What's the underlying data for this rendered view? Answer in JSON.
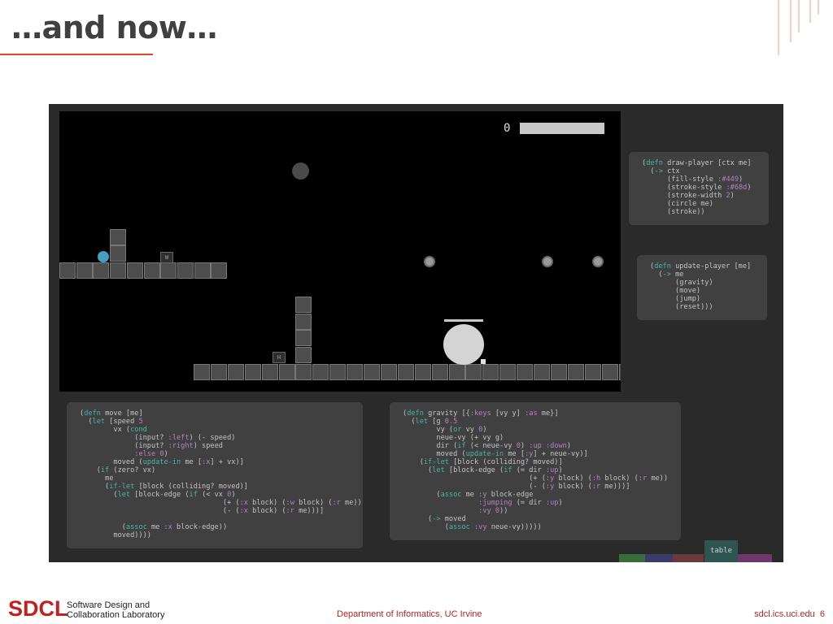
{
  "slide": {
    "title": "…and now…",
    "page_number": "6"
  },
  "colors": {
    "accent": "#e0491b",
    "brand": "#c0201e",
    "keyword": "#46b5a3",
    "constant": "#b380c8",
    "player": "#449ec0"
  },
  "game": {
    "score": "0",
    "health_fraction": 1.0,
    "markers": [
      "W",
      "H"
    ]
  },
  "code_panels": {
    "draw_player": [
      [
        [
          "p",
          "("
        ],
        [
          "k",
          "defn"
        ],
        [
          "p",
          " draw-player [ctx me]"
        ]
      ],
      [
        [
          "p",
          "  ("
        ],
        [
          "k",
          "->"
        ],
        [
          "p",
          " ctx"
        ]
      ],
      [
        [
          "p",
          "      (fill-style "
        ],
        [
          "c",
          ":#449"
        ],
        [
          "p",
          ")"
        ]
      ],
      [
        [
          "p",
          "      (stroke-style "
        ],
        [
          "c",
          ":#68d"
        ],
        [
          "p",
          ")"
        ]
      ],
      [
        [
          "p",
          "      (stroke-width "
        ],
        [
          "c",
          "2"
        ],
        [
          "p",
          ")"
        ]
      ],
      [
        [
          "p",
          "      (circle me)"
        ]
      ],
      [
        [
          "p",
          "      (stroke))"
        ]
      ]
    ],
    "update_player": [
      [
        [
          "p",
          "("
        ],
        [
          "k",
          "defn"
        ],
        [
          "p",
          " update-player [me]"
        ]
      ],
      [
        [
          "p",
          "  ("
        ],
        [
          "k",
          "->"
        ],
        [
          "p",
          " me"
        ]
      ],
      [
        [
          "p",
          "      (gravity)"
        ]
      ],
      [
        [
          "p",
          "      (move)"
        ]
      ],
      [
        [
          "p",
          "      (jump)"
        ]
      ],
      [
        [
          "p",
          "      (reset)))"
        ]
      ]
    ],
    "move": [
      [
        [
          "p",
          "("
        ],
        [
          "k",
          "defn"
        ],
        [
          "p",
          " move [me]"
        ]
      ],
      [
        [
          "p",
          "  ("
        ],
        [
          "k",
          "let"
        ],
        [
          "p",
          " [speed "
        ],
        [
          "c",
          "5"
        ]
      ],
      [
        [
          "p",
          "        vx ("
        ],
        [
          "k",
          "cond"
        ]
      ],
      [
        [
          "p",
          "             (input? "
        ],
        [
          "c",
          ":left"
        ],
        [
          "p",
          ") (- speed)"
        ]
      ],
      [
        [
          "p",
          "             (input? "
        ],
        [
          "c",
          ":right"
        ],
        [
          "p",
          ") speed"
        ]
      ],
      [
        [
          "p",
          "             "
        ],
        [
          "c",
          ":else"
        ],
        [
          "p",
          " "
        ],
        [
          "c",
          "0"
        ],
        [
          "p",
          ")"
        ]
      ],
      [
        [
          "p",
          "        moved ("
        ],
        [
          "k",
          "update-in"
        ],
        [
          "p",
          " me ["
        ],
        [
          "c",
          ":x"
        ],
        [
          "p",
          "] + vx)]"
        ]
      ],
      [
        [
          "p",
          "    ("
        ],
        [
          "k",
          "if"
        ],
        [
          "p",
          " (zero? vx)"
        ]
      ],
      [
        [
          "p",
          "      me"
        ]
      ],
      [
        [
          "p",
          "      ("
        ],
        [
          "k",
          "if-let"
        ],
        [
          "p",
          " [block (colliding? moved)]"
        ]
      ],
      [
        [
          "p",
          "        ("
        ],
        [
          "k",
          "let"
        ],
        [
          "p",
          " [block-edge ("
        ],
        [
          "k",
          "if"
        ],
        [
          "p",
          " (< vx "
        ],
        [
          "c",
          "0"
        ],
        [
          "p",
          ")"
        ]
      ],
      [
        [
          "p",
          "                                  (+ ("
        ],
        [
          "c",
          ":x"
        ],
        [
          "p",
          " block) ("
        ],
        [
          "c",
          ":w"
        ],
        [
          "p",
          " block) ("
        ],
        [
          "c",
          ":r"
        ],
        [
          "p",
          " me))"
        ]
      ],
      [
        [
          "p",
          "                                  (- ("
        ],
        [
          "c",
          ":x"
        ],
        [
          "p",
          " block) ("
        ],
        [
          "c",
          ":r"
        ],
        [
          "p",
          " me)))]"
        ]
      ],
      [
        [
          "p",
          ""
        ]
      ],
      [
        [
          "p",
          "          ("
        ],
        [
          "k",
          "assoc"
        ],
        [
          "p",
          " me "
        ],
        [
          "c",
          ":x"
        ],
        [
          "p",
          " block-edge))"
        ]
      ],
      [
        [
          "p",
          "        moved))))"
        ]
      ]
    ],
    "gravity": [
      [
        [
          "p",
          "("
        ],
        [
          "k",
          "defn"
        ],
        [
          "p",
          " gravity [{"
        ],
        [
          "c",
          ":keys"
        ],
        [
          "p",
          " [vy y] "
        ],
        [
          "c",
          ":as"
        ],
        [
          "p",
          " me}]"
        ]
      ],
      [
        [
          "p",
          "  ("
        ],
        [
          "k",
          "let"
        ],
        [
          "p",
          " [g "
        ],
        [
          "c",
          "0.5"
        ]
      ],
      [
        [
          "p",
          "        vy ("
        ],
        [
          "k",
          "or"
        ],
        [
          "p",
          " vy "
        ],
        [
          "c",
          "0"
        ],
        [
          "p",
          ")"
        ]
      ],
      [
        [
          "p",
          "        neue-vy (+ vy g)"
        ]
      ],
      [
        [
          "p",
          "        dir ("
        ],
        [
          "k",
          "if"
        ],
        [
          "p",
          " (< neue-vy "
        ],
        [
          "c",
          "0"
        ],
        [
          "p",
          ") "
        ],
        [
          "c",
          ":up"
        ],
        [
          "p",
          " "
        ],
        [
          "c",
          ":down"
        ],
        [
          "p",
          ")"
        ]
      ],
      [
        [
          "p",
          "        moved ("
        ],
        [
          "k",
          "update-in"
        ],
        [
          "p",
          " me ["
        ],
        [
          "c",
          ":y"
        ],
        [
          "p",
          "] + neue-vy)]"
        ]
      ],
      [
        [
          "p",
          "    ("
        ],
        [
          "k",
          "if-let"
        ],
        [
          "p",
          " [block (colliding? moved)]"
        ]
      ],
      [
        [
          "p",
          "      ("
        ],
        [
          "k",
          "let"
        ],
        [
          "p",
          " [block-edge ("
        ],
        [
          "k",
          "if"
        ],
        [
          "p",
          " (= dir "
        ],
        [
          "c",
          ":up"
        ],
        [
          "p",
          ")"
        ]
      ],
      [
        [
          "p",
          "                              (+ ("
        ],
        [
          "c",
          ":y"
        ],
        [
          "p",
          " block) ("
        ],
        [
          "c",
          ":h"
        ],
        [
          "p",
          " block) ("
        ],
        [
          "c",
          ":r"
        ],
        [
          "p",
          " me))"
        ]
      ],
      [
        [
          "p",
          "                              (- ("
        ],
        [
          "c",
          ":y"
        ],
        [
          "p",
          " block) ("
        ],
        [
          "c",
          ":r"
        ],
        [
          "p",
          " me)))]"
        ]
      ],
      [
        [
          "p",
          "        ("
        ],
        [
          "k",
          "assoc"
        ],
        [
          "p",
          " me "
        ],
        [
          "c",
          ":y"
        ],
        [
          "p",
          " block-edge"
        ]
      ],
      [
        [
          "p",
          "                  "
        ],
        [
          "c",
          ":jumping"
        ],
        [
          "p",
          " (= dir "
        ],
        [
          "c",
          ":up"
        ],
        [
          "p",
          ")"
        ]
      ],
      [
        [
          "p",
          "                  "
        ],
        [
          "c",
          ":vy"
        ],
        [
          "p",
          " "
        ],
        [
          "c",
          "0"
        ],
        [
          "p",
          "))"
        ]
      ],
      [
        [
          "p",
          "      ("
        ],
        [
          "k",
          "->"
        ],
        [
          "p",
          " moved"
        ]
      ],
      [
        [
          "p",
          "          ("
        ],
        [
          "k",
          "assoc"
        ],
        [
          "p",
          " "
        ],
        [
          "c",
          ":vy"
        ],
        [
          "p",
          " neue-vy)))))"
        ]
      ]
    ]
  },
  "bottom_bar": {
    "table_label": "table",
    "swatch_colors": [
      "#3a6b3a",
      "#3a3a6b",
      "#6b3a3a",
      "#6b3a6b"
    ]
  },
  "footer": {
    "logo": "SDCL",
    "org_line1": "Software Design and",
    "org_line2": "Collaboration Laboratory",
    "department": "Department of Informatics, UC Irvine",
    "site": "sdcl.ics.uci.edu"
  }
}
